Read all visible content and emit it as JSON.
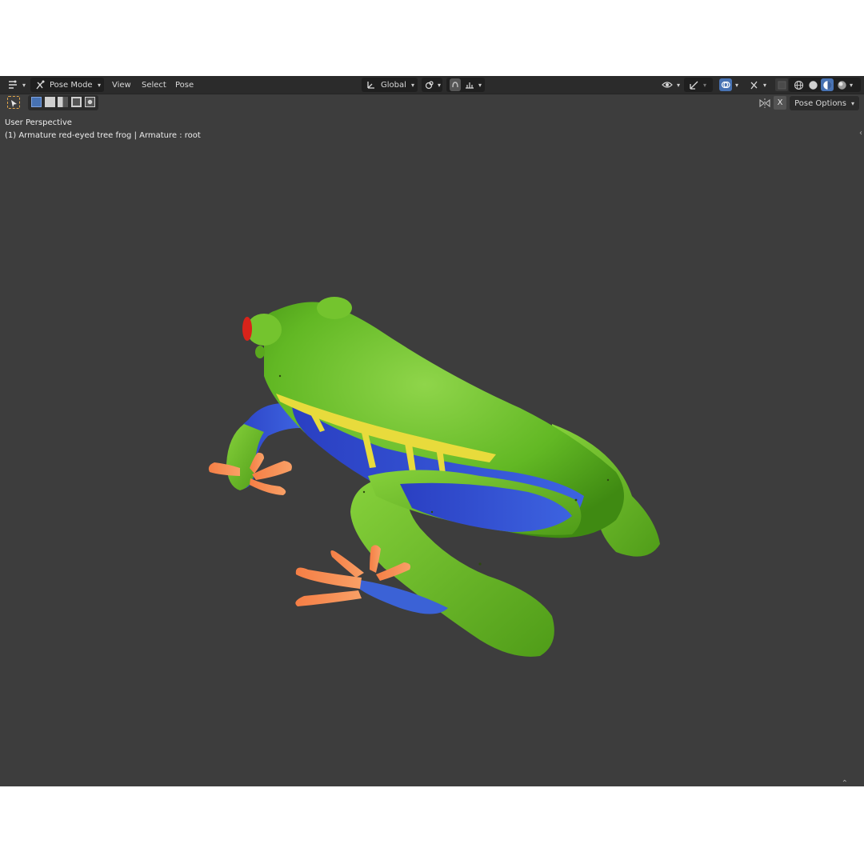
{
  "header": {
    "mode_label": "Pose Mode",
    "menus": [
      "View",
      "Select",
      "Pose"
    ],
    "transform_orientation": "Global"
  },
  "toolbar": {
    "pose_options_label": "Pose Options",
    "close_label": "X"
  },
  "viewport": {
    "perspective_label": "User Perspective",
    "object_info": "(1) Armature red-eyed tree frog | Armature : root"
  },
  "colors": {
    "viewport_bg": "#3d3d3d",
    "header_bg": "#2b2b2b",
    "accent_blue": "#4772b3",
    "frog_green": "#6cc22a",
    "frog_blue": "#2f4fd0",
    "frog_yellow": "#e6d83a",
    "frog_orange": "#f08a4a",
    "frog_eye_red": "#d8231a"
  },
  "icons": [
    "editor-type-icon",
    "pose-mode-icon",
    "orientation-icon",
    "pivot-icon",
    "snap-icon",
    "proportional-icon",
    "visibility-icon",
    "gizmo-icon",
    "overlay-icon",
    "xray-icon",
    "wireframe-shading-icon",
    "solid-shading-icon",
    "material-shading-icon",
    "rendered-shading-icon",
    "select-tool-icon"
  ]
}
